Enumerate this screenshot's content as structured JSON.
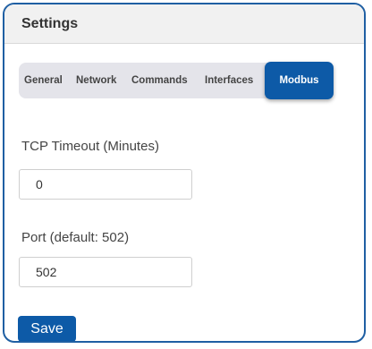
{
  "header": {
    "title": "Settings"
  },
  "tabs": [
    {
      "label": "General",
      "active": false
    },
    {
      "label": "Network",
      "active": false
    },
    {
      "label": "Commands",
      "active": false
    },
    {
      "label": "Interfaces",
      "active": false
    },
    {
      "label": "Modbus",
      "active": true
    }
  ],
  "form": {
    "timeout": {
      "label": "TCP Timeout (Minutes)",
      "value": "0"
    },
    "port": {
      "label": "Port (default: 502)",
      "value": "502"
    },
    "save_label": "Save"
  },
  "colors": {
    "accent": "#0d5aa7",
    "border": "#1f5fa3",
    "header_bg": "#f1f1f1",
    "tabbar_bg": "#e4e4ea"
  }
}
